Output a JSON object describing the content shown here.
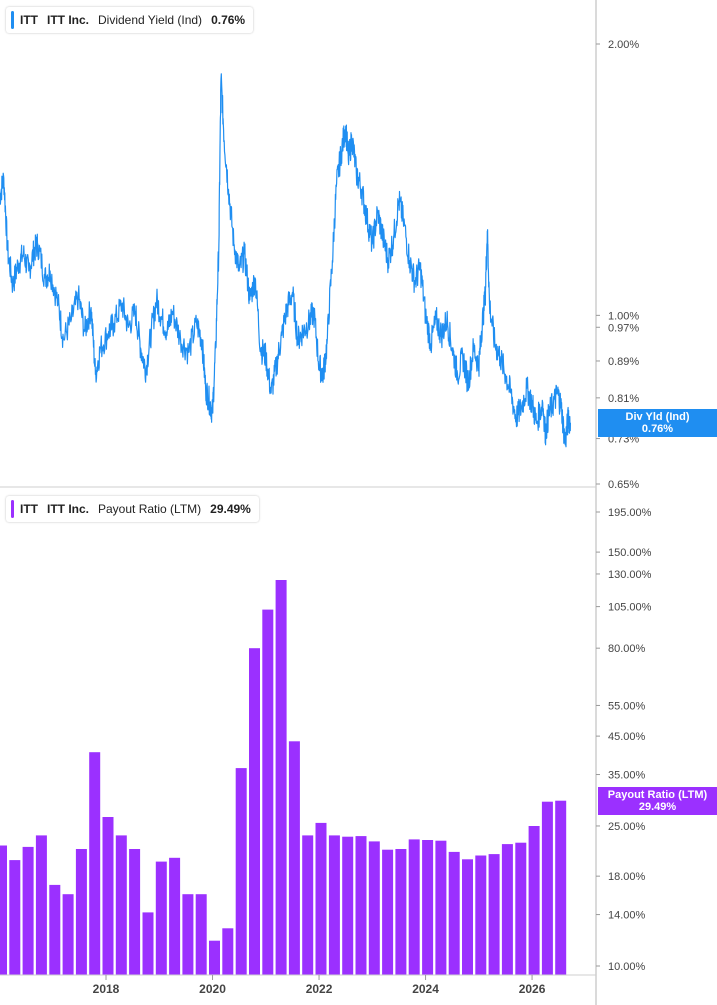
{
  "colors": {
    "yield": "#1f8ef1",
    "payout": "#9b30ff",
    "axis": "#999999",
    "text": "#444444"
  },
  "panels": {
    "yield": {
      "ticker": "ITT",
      "company": "ITT Inc.",
      "metric": "Dividend Yield (Ind)",
      "value": "0.76%",
      "tag_line1": "Div Yld (Ind)",
      "tag_line2": "0.76%"
    },
    "payout": {
      "ticker": "ITT",
      "company": "ITT Inc.",
      "metric": "Payout Ratio (LTM)",
      "value": "29.49%",
      "tag_line1": "Payout Ratio (LTM)",
      "tag_line2": "29.49%"
    }
  },
  "chart_data": [
    {
      "type": "line",
      "title": "ITT ITT Inc. Dividend Yield (Ind) 0.76%",
      "series": [
        {
          "name": "Dividend Yield (Ind)",
          "unit": "%",
          "points": [
            [
              2016.0,
              1.35
            ],
            [
              2016.08,
              1.42
            ],
            [
              2016.15,
              1.18
            ],
            [
              2016.25,
              1.08
            ],
            [
              2016.35,
              1.14
            ],
            [
              2016.45,
              1.17
            ],
            [
              2016.55,
              1.12
            ],
            [
              2016.65,
              1.18
            ],
            [
              2016.72,
              1.2
            ],
            [
              2016.85,
              1.1
            ],
            [
              2016.95,
              1.12
            ],
            [
              2017.1,
              1.03
            ],
            [
              2017.2,
              0.94
            ],
            [
              2017.35,
              0.99
            ],
            [
              2017.48,
              1.05
            ],
            [
              2017.6,
              0.96
            ],
            [
              2017.72,
              1.02
            ],
            [
              2017.8,
              0.86
            ],
            [
              2017.9,
              0.92
            ],
            [
              2018.05,
              0.96
            ],
            [
              2018.15,
              0.98
            ],
            [
              2018.3,
              1.03
            ],
            [
              2018.42,
              0.97
            ],
            [
              2018.55,
              1.01
            ],
            [
              2018.65,
              0.92
            ],
            [
              2018.75,
              0.87
            ],
            [
              2018.85,
              0.96
            ],
            [
              2018.95,
              1.04
            ],
            [
              2019.05,
              0.99
            ],
            [
              2019.15,
              0.96
            ],
            [
              2019.25,
              1.01
            ],
            [
              2019.4,
              0.94
            ],
            [
              2019.55,
              0.91
            ],
            [
              2019.7,
              0.98
            ],
            [
              2019.8,
              0.94
            ],
            [
              2019.87,
              0.83
            ],
            [
              2019.95,
              0.8
            ],
            [
              2020.0,
              0.78
            ],
            [
              2020.06,
              0.92
            ],
            [
              2020.12,
              1.2
            ],
            [
              2020.16,
              1.83
            ],
            [
              2020.22,
              1.56
            ],
            [
              2020.3,
              1.38
            ],
            [
              2020.4,
              1.2
            ],
            [
              2020.5,
              1.12
            ],
            [
              2020.6,
              1.17
            ],
            [
              2020.7,
              1.04
            ],
            [
              2020.8,
              1.1
            ],
            [
              2020.9,
              0.92
            ],
            [
              2021.0,
              0.9
            ],
            [
              2021.1,
              0.82
            ],
            [
              2021.2,
              0.88
            ],
            [
              2021.3,
              0.95
            ],
            [
              2021.4,
              1.02
            ],
            [
              2021.5,
              1.06
            ],
            [
              2021.6,
              0.94
            ],
            [
              2021.7,
              0.96
            ],
            [
              2021.8,
              0.98
            ],
            [
              2021.9,
              1.01
            ],
            [
              2022.0,
              0.88
            ],
            [
              2022.08,
              0.86
            ],
            [
              2022.15,
              0.93
            ],
            [
              2022.25,
              1.15
            ],
            [
              2022.33,
              1.4
            ],
            [
              2022.42,
              1.52
            ],
            [
              2022.5,
              1.62
            ],
            [
              2022.55,
              1.49
            ],
            [
              2022.62,
              1.57
            ],
            [
              2022.7,
              1.44
            ],
            [
              2022.8,
              1.38
            ],
            [
              2022.9,
              1.28
            ],
            [
              2023.0,
              1.2
            ],
            [
              2023.1,
              1.3
            ],
            [
              2023.2,
              1.22
            ],
            [
              2023.3,
              1.15
            ],
            [
              2023.4,
              1.22
            ],
            [
              2023.5,
              1.34
            ],
            [
              2023.58,
              1.28
            ],
            [
              2023.7,
              1.15
            ],
            [
              2023.8,
              1.09
            ],
            [
              2023.9,
              1.13
            ],
            [
              2024.0,
              1.0
            ],
            [
              2024.1,
              0.93
            ],
            [
              2024.2,
              0.99
            ],
            [
              2024.3,
              0.95
            ],
            [
              2024.4,
              0.99
            ],
            [
              2024.5,
              0.92
            ],
            [
              2024.6,
              0.86
            ],
            [
              2024.7,
              0.9
            ],
            [
              2024.8,
              0.84
            ],
            [
              2024.9,
              0.92
            ],
            [
              2025.0,
              0.88
            ],
            [
              2025.05,
              0.96
            ],
            [
              2025.12,
              1.05
            ],
            [
              2025.16,
              1.24
            ],
            [
              2025.2,
              1.03
            ],
            [
              2025.3,
              0.93
            ],
            [
              2025.4,
              0.9
            ],
            [
              2025.5,
              0.86
            ],
            [
              2025.6,
              0.82
            ],
            [
              2025.7,
              0.77
            ],
            [
              2025.8,
              0.79
            ],
            [
              2025.9,
              0.83
            ],
            [
              2026.0,
              0.8
            ],
            [
              2026.08,
              0.76
            ],
            [
              2026.2,
              0.8
            ],
            [
              2026.25,
              0.74
            ],
            [
              2026.32,
              0.78
            ],
            [
              2026.4,
              0.8
            ],
            [
              2026.48,
              0.82
            ],
            [
              2026.55,
              0.79
            ],
            [
              2026.62,
              0.72
            ],
            [
              2026.68,
              0.77
            ],
            [
              2026.72,
              0.76
            ]
          ]
        }
      ],
      "y_scale": "log",
      "ylim": [
        0.65,
        2.2
      ],
      "xlim": [
        2016.0,
        2026.9
      ],
      "y_ticks": [
        {
          "value": 2.0,
          "label": "2.00%"
        },
        {
          "value": 1.0,
          "label": "1.00%"
        },
        {
          "value": 0.97,
          "label": "0.97%"
        },
        {
          "value": 0.89,
          "label": "0.89%"
        },
        {
          "value": 0.81,
          "label": "0.81%"
        },
        {
          "value": 0.73,
          "label": "0.73%"
        },
        {
          "value": 0.65,
          "label": "0.65%"
        }
      ],
      "last_value": 0.76,
      "grid": false,
      "legend": "top-left"
    },
    {
      "type": "bar",
      "title": "ITT ITT Inc. Payout Ratio (LTM) 29.49%",
      "series": [
        {
          "name": "Payout Ratio (LTM)",
          "unit": "%",
          "x": [
            2016.0,
            2016.25,
            2016.5,
            2016.75,
            2017.0,
            2017.25,
            2017.5,
            2017.75,
            2018.0,
            2018.25,
            2018.5,
            2018.75,
            2019.0,
            2019.25,
            2019.5,
            2019.75,
            2020.0,
            2020.25,
            2020.5,
            2020.75,
            2021.0,
            2021.25,
            2021.5,
            2021.75,
            2022.0,
            2022.25,
            2022.5,
            2022.75,
            2023.0,
            2023.25,
            2023.5,
            2023.75,
            2024.0,
            2024.25,
            2024.5,
            2024.75,
            2025.0,
            2025.25,
            2025.5,
            2025.75,
            2026.0,
            2026.25,
            2026.5
          ],
          "values": [
            22.0,
            20.0,
            21.8,
            23.5,
            17.0,
            16.0,
            21.5,
            40.5,
            26.5,
            23.5,
            21.5,
            14.2,
            19.8,
            20.3,
            16.0,
            16.0,
            11.8,
            12.8,
            36.5,
            80.0,
            103.0,
            125.0,
            43.5,
            23.5,
            25.5,
            23.5,
            23.3,
            23.4,
            22.6,
            21.4,
            21.5,
            22.9,
            22.8,
            22.7,
            21.1,
            20.1,
            20.6,
            20.8,
            22.2,
            22.4,
            25.0,
            29.3,
            29.49
          ]
        }
      ],
      "y_scale": "log",
      "ylim": [
        9.5,
        210
      ],
      "y_ticks": [
        {
          "value": 195,
          "label": "195.00%"
        },
        {
          "value": 150,
          "label": "150.00%"
        },
        {
          "value": 130,
          "label": "130.00%"
        },
        {
          "value": 105,
          "label": "105.00%"
        },
        {
          "value": 80,
          "label": "80.00%"
        },
        {
          "value": 55,
          "label": "55.00%"
        },
        {
          "value": 45,
          "label": "45.00%"
        },
        {
          "value": 35,
          "label": "35.00%"
        },
        {
          "value": 25,
          "label": "25.00%"
        },
        {
          "value": 18,
          "label": "18.00%"
        },
        {
          "value": 14,
          "label": "14.00%"
        },
        {
          "value": 10,
          "label": "10.00%"
        }
      ],
      "x_ticks": [
        {
          "value": 2018,
          "label": "2018"
        },
        {
          "value": 2020,
          "label": "2020"
        },
        {
          "value": 2022,
          "label": "2022"
        },
        {
          "value": 2024,
          "label": "2024"
        },
        {
          "value": 2026,
          "label": "2026"
        }
      ],
      "last_value": 29.49,
      "grid": false,
      "legend": "top-left"
    }
  ]
}
